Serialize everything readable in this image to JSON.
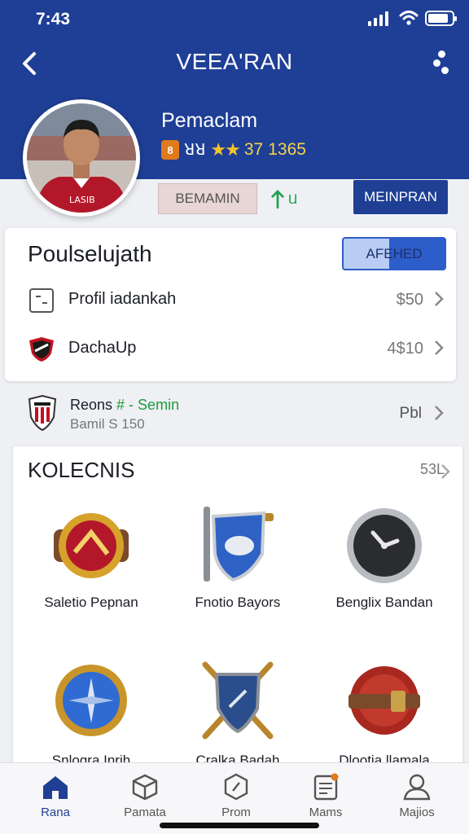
{
  "status_bar": {
    "time": "7:43",
    "battery_level": 0.85
  },
  "header": {
    "title": "VEEA'RAN"
  },
  "player": {
    "name": "Pemaclam",
    "rank_badge": "8",
    "rank_text": "ꓤꓤ",
    "stars": "★★",
    "rating": "37",
    "rating_extra": "1365",
    "pill_label": "BEMAMIN",
    "stat_up_label": "ᥙ",
    "action_label": "MEINPRAN"
  },
  "card1": {
    "title": "Poulselujath",
    "button_label": "AFEHED",
    "rows": [
      {
        "label": "Profil iadankah",
        "value": "$50",
        "icon": "square-icon"
      },
      {
        "label": "DachaUp",
        "value": "4$10",
        "icon": "club-crest-icon"
      }
    ]
  },
  "league": {
    "name": "Reons",
    "tag": "# - Semin",
    "sub": "Bamil S 150",
    "value": "Pbl"
  },
  "collections": {
    "title": "KOLECNIS",
    "count": "53L",
    "items": [
      {
        "label": "Saletio Pepnan",
        "icon": "gold-medal-icon"
      },
      {
        "label": "Fnotio Bayors",
        "icon": "blue-shield-icon"
      },
      {
        "label": "Benglix Bandan",
        "icon": "clock-icon"
      },
      {
        "label": "Snlogra Inrih",
        "icon": "blue-compass-icon"
      },
      {
        "label": "Cralka Badah",
        "icon": "crossed-shield-icon"
      },
      {
        "label": "Dlootia llamala",
        "icon": "red-belt-icon"
      }
    ]
  },
  "nav": {
    "items": [
      {
        "label": "Rana",
        "icon": "home-icon"
      },
      {
        "label": "Pamata",
        "icon": "box-icon"
      },
      {
        "label": "Prom",
        "icon": "badge-icon"
      },
      {
        "label": "Mams",
        "icon": "tablet-icon"
      },
      {
        "label": "Majios",
        "icon": "profile-icon"
      }
    ]
  },
  "colors": {
    "primary": "#1f3f96",
    "gold": "#f5c22b",
    "green": "#1ea24e"
  }
}
